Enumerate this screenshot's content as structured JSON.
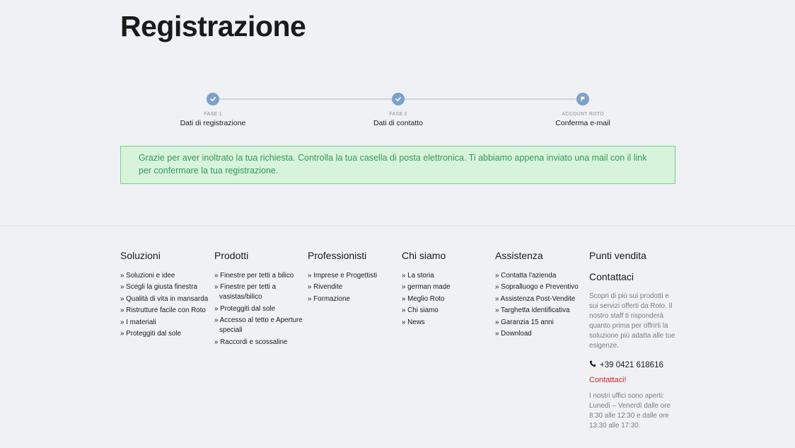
{
  "page": {
    "title": "Registrazione"
  },
  "steps": [
    {
      "phase": "FASE 1",
      "name": "Dati di registrazione",
      "icon": "check-icon"
    },
    {
      "phase": "FASE 2",
      "name": "Dati di contatto",
      "icon": "check-icon"
    },
    {
      "phase": "ACCOUNT ROTO",
      "name": "Conferma e-mail",
      "icon": "flag-icon"
    }
  ],
  "alert": {
    "text": "Grazie per aver inoltrato la tua richiesta. Controlla la tua casella di posta elettronica. Ti abbiamo appena inviato una mail con il link per confermare la tua registrazione."
  },
  "footer": {
    "soluzioni": {
      "title": "Soluzioni",
      "items": [
        "Soluzioni e idee",
        "Scegli la giusta finestra",
        "Qualità di vita in mansarda",
        "Ristrutture facile con Roto",
        "I materiali",
        "Proteggiti dal sole"
      ]
    },
    "prodotti": {
      "title": "Prodotti",
      "items": [
        "Finestre per tetti a bilico",
        "Finestre per tetti a vasistas/bilico",
        "Proteggiti dal sole",
        "Accesso al tetto e Aperture speciali",
        "Raccordi e scossaline"
      ]
    },
    "professionisti": {
      "title": "Professionisti",
      "items": [
        "Imprese e Progettisti",
        "Rivendite",
        "Formazione"
      ]
    },
    "chisiamo": {
      "title": "Chi siamo",
      "items": [
        "La storia",
        "german made",
        "Meglio Roto",
        "Chi siamo",
        "News"
      ]
    },
    "assistenza": {
      "title": "Assistenza",
      "items": [
        "Contatta l'azienda",
        "Sopralluogo e Preventivo",
        "Assistenza Post-Vendite",
        "Targhetta identificativa",
        "Garanzia 15 anni",
        "Download"
      ]
    },
    "punti": {
      "title": "Punti vendita",
      "contact_title": "Contattaci",
      "description": "Scopri di più sui prodotti e sui servizi offerti da Roto. Il nostro staff ti risponderà quanto prima per offrirti la soluzione più adatta alle tue esigenze.",
      "phone": "+39 0421 618616",
      "contact_link": "Contattaci!",
      "hours": "I nostri uffici sono aperti: Lunedì – Venerdì dalle ore 8:30 alle 12:30 e dalle ore 13:30 alle 17:30."
    }
  },
  "colors": {
    "accent_blue": "#7ca1c9",
    "alert_bg": "#d8f3dc",
    "alert_text": "#2e9c55",
    "link_red": "#d4222c"
  }
}
